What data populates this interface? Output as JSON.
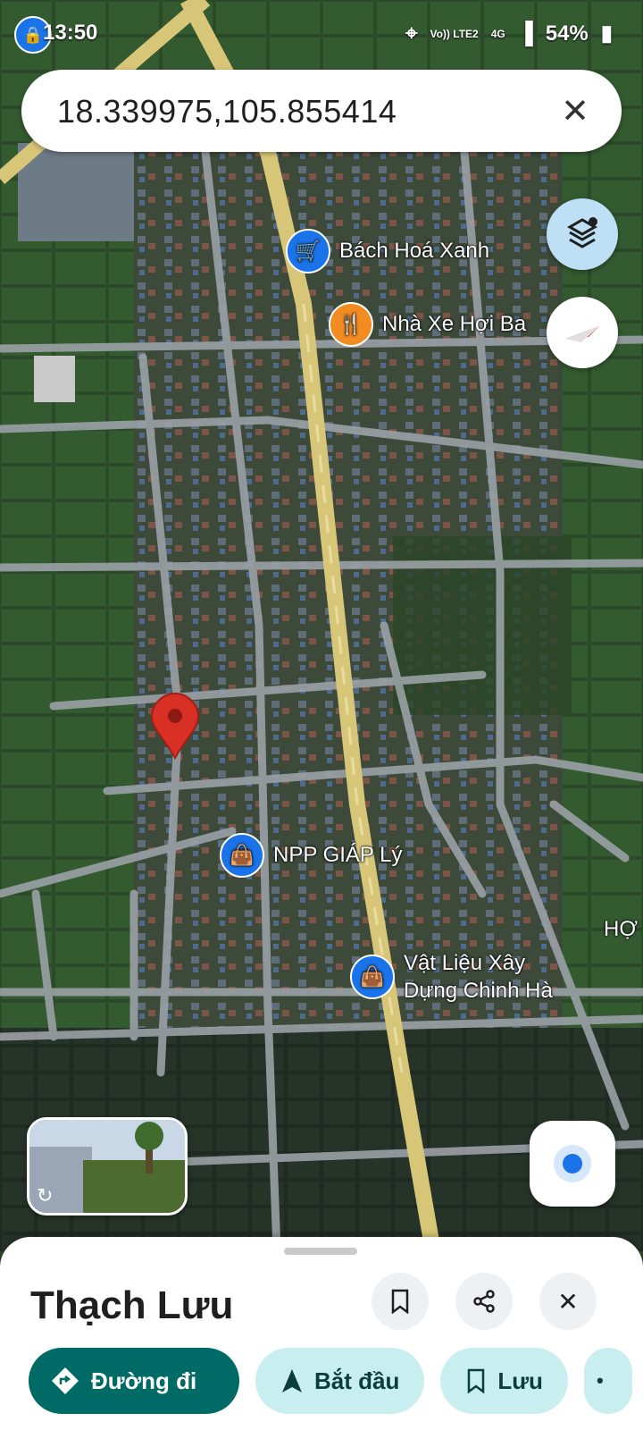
{
  "status_bar": {
    "time": "13:50",
    "network": "Vo)) LTE2",
    "mobile": "4G",
    "battery": "54%"
  },
  "search": {
    "query": "18.339975,105.855414",
    "clear_icon": "close-icon"
  },
  "map": {
    "pois": [
      {
        "name": "Bách Hoá Xanh",
        "icon": "shopping-cart-icon",
        "color": "#1a73e8"
      },
      {
        "name": "Nhà Xe Hợi Ba",
        "icon": "fork-knife-icon",
        "color": "#f28b20"
      },
      {
        "name": "NPP GIÁP Lý",
        "icon": "shopping-bag-icon",
        "color": "#1a73e8"
      },
      {
        "name_line1": "Vật Liệu Xây",
        "name_line2": "Dựng Chinh Hà",
        "icon": "shopping-bag-icon",
        "color": "#1a73e8"
      },
      {
        "name": "HỢ"
      }
    ],
    "marker": {
      "icon": "location-pin-icon",
      "color": "#d93025"
    }
  },
  "place": {
    "title": "Thạch Lưu"
  },
  "actions": {
    "directions": "Đường đi",
    "start": "Bắt đầu",
    "save": "Lưu"
  },
  "colors": {
    "primary": "#006b66",
    "secondary": "#c9eef0",
    "accent_blue": "#1a73e8"
  }
}
